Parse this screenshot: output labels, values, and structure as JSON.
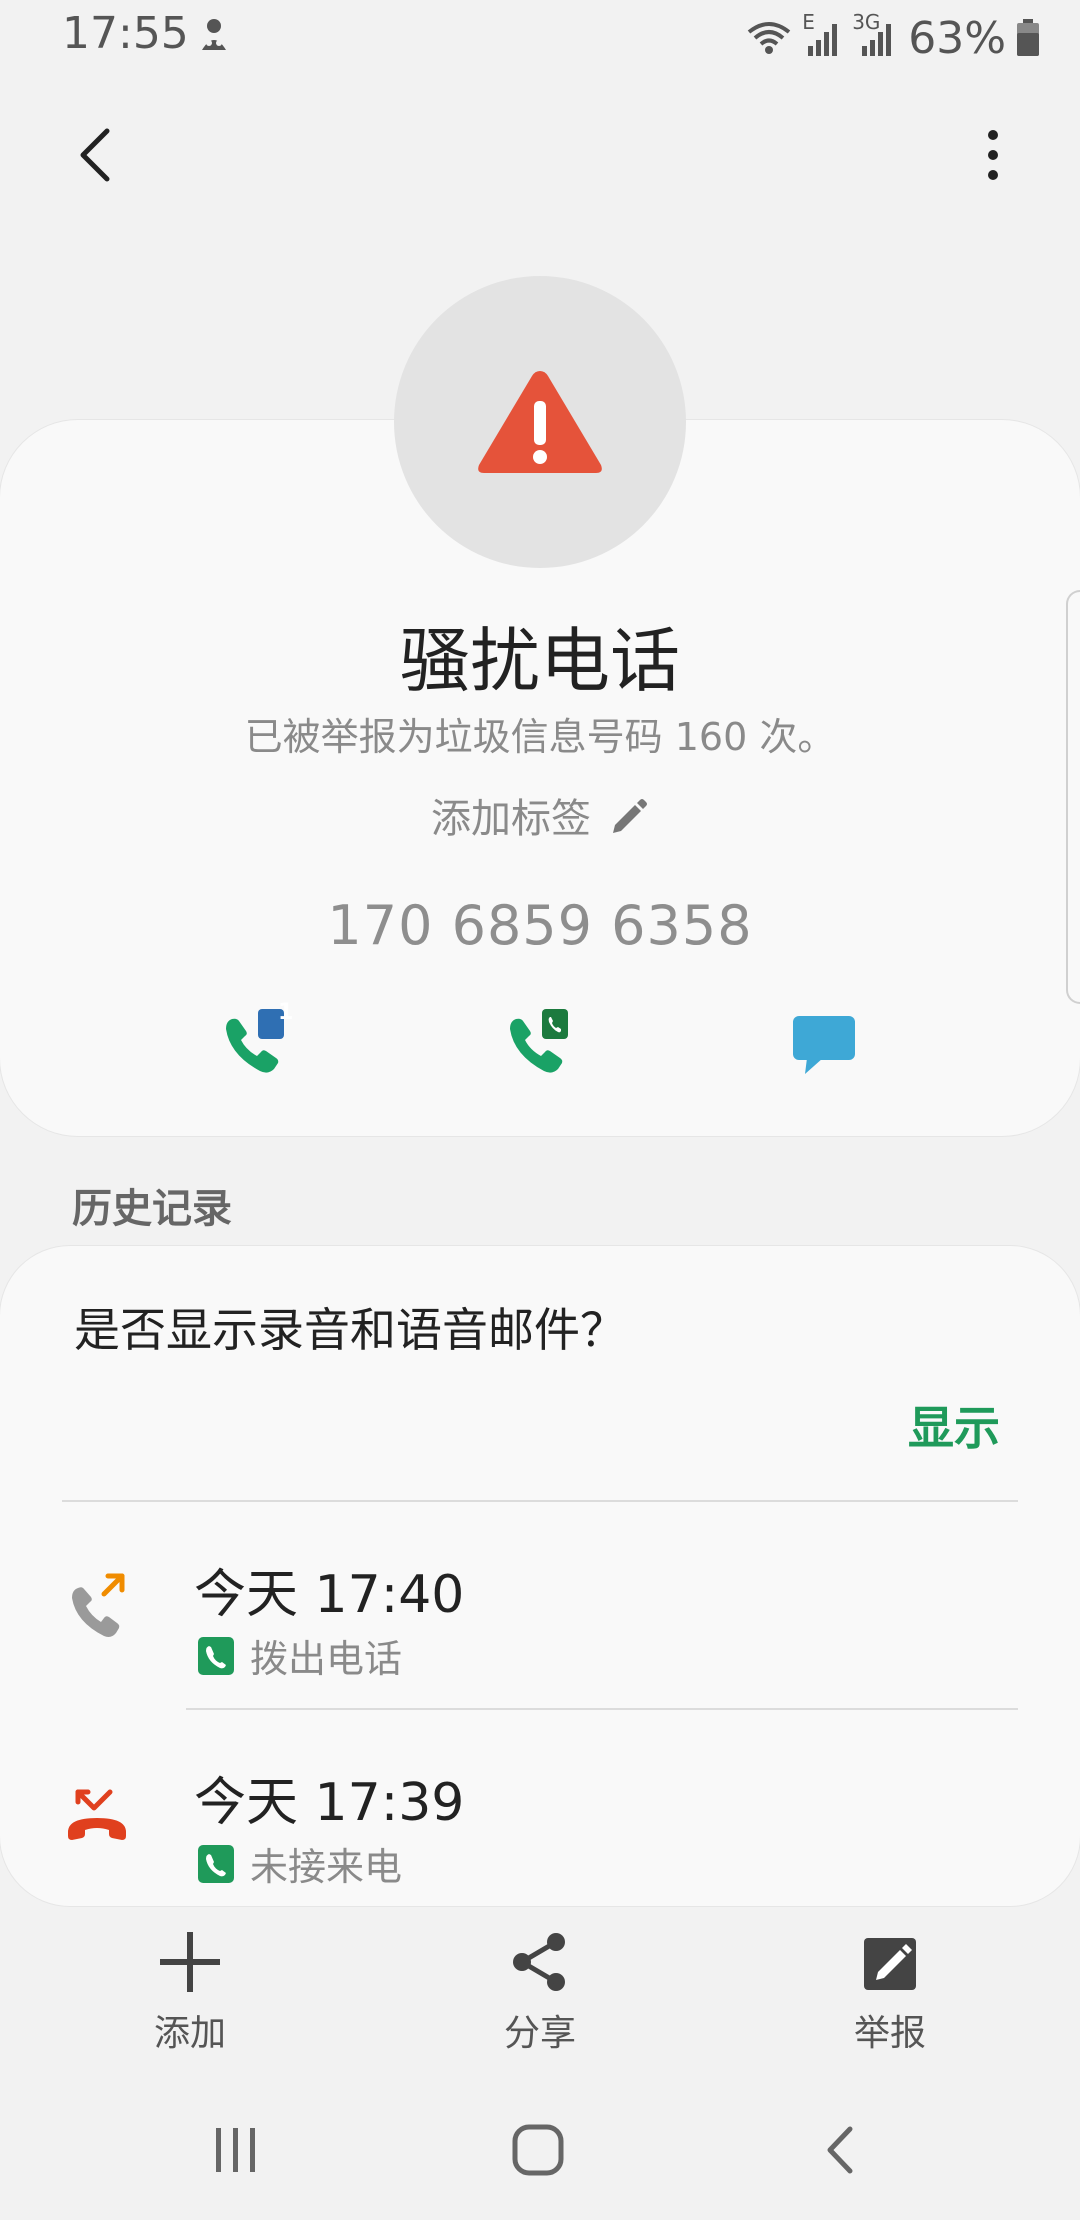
{
  "status_bar": {
    "time": "17:55",
    "network_e": "E",
    "network_3g": "3G",
    "battery": "63%"
  },
  "contact": {
    "title": "骚扰电话",
    "subtitle": "已被举报为垃圾信息号码 160 次。",
    "add_tag": "添加标签",
    "number": "170 6859 6358",
    "sim1_badge": "1"
  },
  "history": {
    "label": "历史记录",
    "voicemail_question": "是否显示录音和语音邮件？",
    "show_label": "显示",
    "calls": [
      {
        "time": "今天 17:40",
        "type": "拨出电话"
      },
      {
        "time": "今天 17:39",
        "type": "未接来电"
      }
    ]
  },
  "bottom_bar": {
    "add": "添加",
    "share": "分享",
    "report": "举报"
  },
  "colors": {
    "warning": "#e5533a",
    "green": "#1f9a5a",
    "message": "#3ea8d6",
    "missed": "#e0401e",
    "outgoing_arrow": "#f08c00"
  }
}
